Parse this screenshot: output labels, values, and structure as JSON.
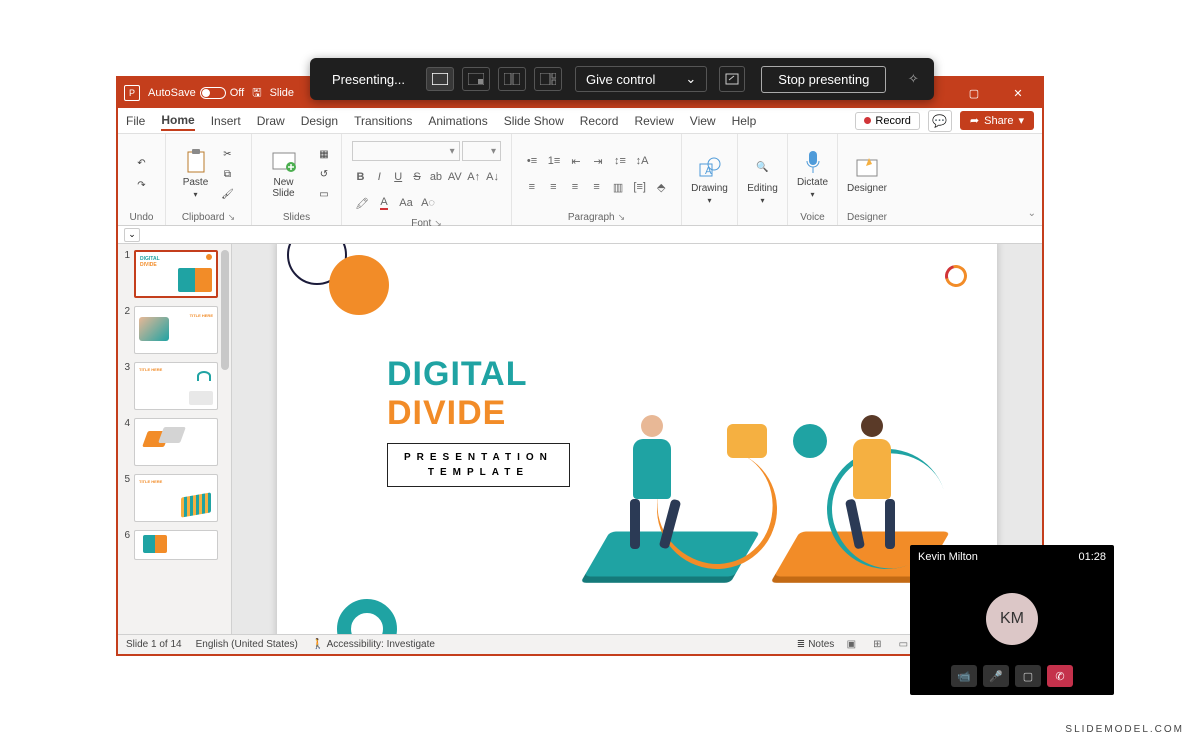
{
  "present_bar": {
    "label": "Presenting...",
    "give_control": "Give control",
    "stop": "Stop presenting"
  },
  "titlebar": {
    "autosave": "AutoSave",
    "autosave_state": "Off",
    "doc_name": "Slide"
  },
  "tabs": {
    "file": "File",
    "home": "Home",
    "insert": "Insert",
    "draw": "Draw",
    "design": "Design",
    "transitions": "Transitions",
    "animations": "Animations",
    "slideshow": "Slide Show",
    "record": "Record",
    "review": "Review",
    "view": "View",
    "help": "Help",
    "record_btn": "Record",
    "share": "Share"
  },
  "ribbon": {
    "undo": "Undo",
    "paste": "Paste",
    "clipboard": "Clipboard",
    "new_slide": "New Slide",
    "slides": "Slides",
    "font": "Font",
    "paragraph": "Paragraph",
    "drawing": "Drawing",
    "editing": "Editing",
    "dictate": "Dictate",
    "voice": "Voice",
    "designer": "Designer",
    "designer_g": "Designer"
  },
  "slide_content": {
    "title1": "DIGITAL",
    "title2": "DIVIDE",
    "sub1": "PRESENTATION",
    "sub2": "TEMPLATE"
  },
  "thumbs": {
    "n1": "1",
    "n2": "2",
    "n3": "3",
    "n4": "4",
    "n5": "5",
    "n6": "6",
    "title_here": "TITLE HERE"
  },
  "status": {
    "slide_of": "Slide 1 of 14",
    "lang": "English (United States)",
    "access": "Accessibility: Investigate",
    "notes": "Notes"
  },
  "call": {
    "name": "Kevin Milton",
    "time": "01:28",
    "initials": "KM"
  },
  "watermark": "SLIDEMODEL.COM"
}
